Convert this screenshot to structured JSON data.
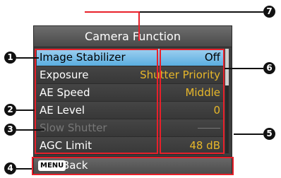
{
  "menu": {
    "title": "Camera Function",
    "items": [
      {
        "label": "Image Stabilizer",
        "value": "Off",
        "selected": true,
        "disabled": false
      },
      {
        "label": "Exposure",
        "value": "Shutter Priority",
        "selected": false,
        "disabled": false
      },
      {
        "label": "AE Speed",
        "value": "Middle",
        "selected": false,
        "disabled": false
      },
      {
        "label": "AE Level",
        "value": "0",
        "selected": false,
        "disabled": false
      },
      {
        "label": "Slow Shutter",
        "value": "",
        "selected": false,
        "disabled": true
      },
      {
        "label": "AGC Limit",
        "value": "48 dB",
        "selected": false,
        "disabled": false
      }
    ],
    "footer": {
      "key": "MENU",
      "label": "Back"
    }
  },
  "callouts": [
    "1",
    "2",
    "3",
    "4",
    "5",
    "6",
    "7"
  ]
}
